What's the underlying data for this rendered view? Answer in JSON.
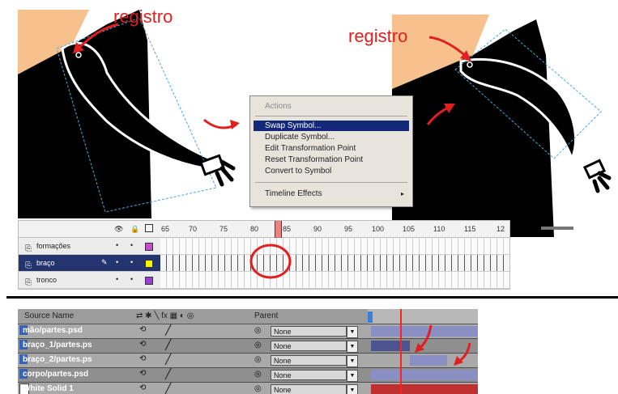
{
  "annotations": {
    "left_label": "registro",
    "right_label": "registro"
  },
  "context_menu": {
    "items": [
      {
        "label": "Actions",
        "state": "disabled"
      },
      {
        "label": "Swap Symbol...",
        "state": "selected"
      },
      {
        "label": "Duplicate Symbol...",
        "state": "normal"
      },
      {
        "label": "Edit Transformation Point",
        "state": "normal"
      },
      {
        "label": "Reset Transformation Point",
        "state": "normal"
      },
      {
        "label": "Convert to Symbol",
        "state": "normal"
      },
      {
        "label": "Timeline Effects",
        "state": "normal",
        "submenu": true
      }
    ],
    "submenu_arrow": "▸"
  },
  "flash_timeline": {
    "ruler_ticks": [
      "65",
      "70",
      "75",
      "80",
      "85",
      "90",
      "95",
      "100",
      "105",
      "110",
      "115",
      "12"
    ],
    "layers": [
      {
        "name": "formações",
        "color": "#c64fd0",
        "selected": false
      },
      {
        "name": "braço",
        "color": "#f4f400",
        "selected": true
      },
      {
        "name": "tronco",
        "color": "#9b3fd6",
        "selected": false
      }
    ]
  },
  "ae_timeline": {
    "headers": {
      "source_name": "Source Name",
      "parent": "Parent"
    },
    "layers": [
      {
        "source": "mão/partes.psd",
        "parent": "None"
      },
      {
        "source": "braço_1/partes.ps",
        "parent": "None"
      },
      {
        "source": "braço_2/partes.ps",
        "parent": "None"
      },
      {
        "source": "corpo/partes.psd",
        "parent": "None"
      },
      {
        "source": "White Solid 1",
        "parent": "None"
      }
    ]
  },
  "colors": {
    "annotation_red": "#e02020",
    "menu_highlight": "#14287a",
    "skin": "#f6c18c",
    "ink": "#000000"
  }
}
